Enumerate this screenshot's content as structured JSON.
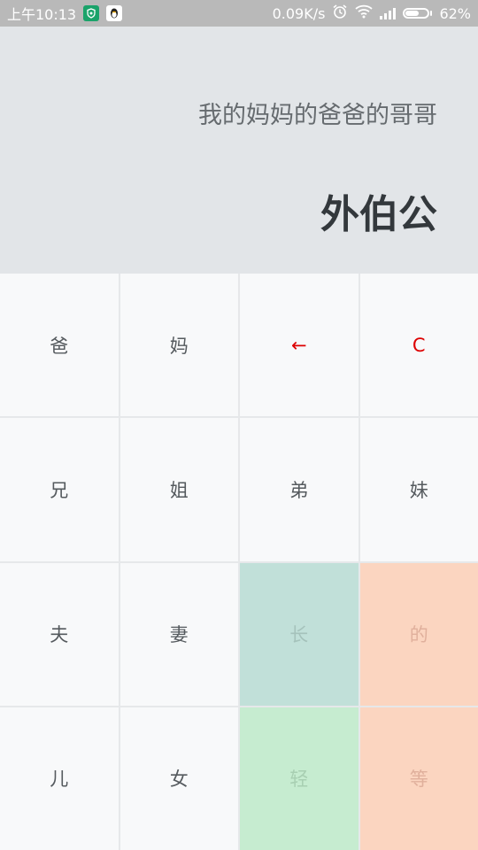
{
  "status_bar": {
    "time": "上午10:13",
    "app_icon_1": "shield-icon",
    "app_icon_2": "qq-penguin-icon",
    "network_speed": "0.09K/s",
    "alarm_icon": "alarm-clock-icon",
    "wifi_icon": "wifi-icon",
    "signal_icon": "signal-bars-icon",
    "battery_icon": "battery-icon",
    "battery_level": 0.62,
    "battery_text": "62%"
  },
  "display": {
    "expression": "我的妈妈的爸爸的哥哥",
    "result": "外伯公"
  },
  "keys": [
    {
      "label": "爸"
    },
    {
      "label": "妈"
    },
    {
      "label": "←"
    },
    {
      "label": "C"
    },
    {
      "label": "兄"
    },
    {
      "label": "姐"
    },
    {
      "label": "弟"
    },
    {
      "label": "妹"
    },
    {
      "label": "夫"
    },
    {
      "label": "妻"
    },
    {
      "label": "长"
    },
    {
      "label": "的"
    },
    {
      "label": "儿"
    },
    {
      "label": "女"
    },
    {
      "label": "轻"
    },
    {
      "label": "等"
    }
  ],
  "colors": {
    "display_bg": "#e2e5e8",
    "key_bg": "#f8f9fa",
    "key_red": "#dd0000",
    "key_teal": "#c1e0d9",
    "key_peach": "#fbd5c0",
    "key_green": "#c6ecd0"
  }
}
